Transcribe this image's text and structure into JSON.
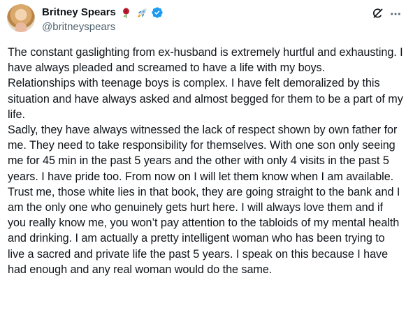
{
  "author": {
    "name": "Britney Spears",
    "handle": "@britneyspears",
    "name_emojis": [
      "rose-emoji",
      "rocket-emoji"
    ],
    "verified": true
  },
  "header_icons": [
    "grok-icon",
    "more-icon"
  ],
  "tweet": {
    "paragraphs": [
      "The constant gaslighting from ex-husband is extremely hurtful and exhausting. I have always pleaded and screamed to have a life with my boys.",
      "Relationships with teenage boys is complex. I have felt demoralized by this situation and have always asked and almost begged for them to be a part of my life.",
      "Sadly, they have always witnessed the lack of respect shown by own father for me. They need to take responsibility for themselves. With one son only seeing me for 45 min in the past 5 years and the other with only 4 visits in the past 5 years. I have pride too. From now on I will let them know when I am available. Trust me, those white lies in that book, they are going straight to the bank and I am the only one who genuinely gets hurt here. I will always love them and if you really know me, you won’t pay attention to the tabloids of my mental health and drinking. I am actually a pretty intelligent woman who has been trying to live a sacred and private life the past 5 years. I speak on this because I have had enough and any real woman would do the same."
    ]
  },
  "colors": {
    "text": "#0f1419",
    "secondary": "#536471",
    "verified": "#1d9bf0"
  }
}
